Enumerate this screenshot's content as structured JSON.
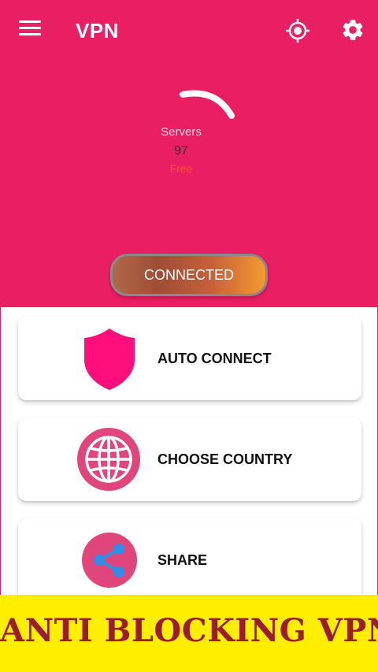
{
  "appbar": {
    "title": "VPN",
    "menu_icon": "hamburger-menu-icon",
    "locate_icon": "location-target-icon",
    "settings_icon": "gear-icon"
  },
  "status": {
    "servers_label": "Servers",
    "servers_count": "97",
    "servers_status": "Free"
  },
  "connect_button": {
    "label": "CONNECTED"
  },
  "menu": [
    {
      "label": "AUTO CONNECT",
      "icon": "shield-icon"
    },
    {
      "label": "CHOOSE COUNTRY",
      "icon": "globe-icon"
    },
    {
      "label": "SHARE",
      "icon": "share-icon"
    }
  ],
  "banner": {
    "text": "ANTI BLOCKING VPN"
  },
  "colors": {
    "primary": "#E91E63",
    "shield": "#FF0F7B",
    "globe": "#E0457B",
    "share_bg": "#E0457B",
    "share_fg": "#2F8FE8",
    "banner_bg": "#FFEE00",
    "banner_text": "#9B1C2C"
  }
}
